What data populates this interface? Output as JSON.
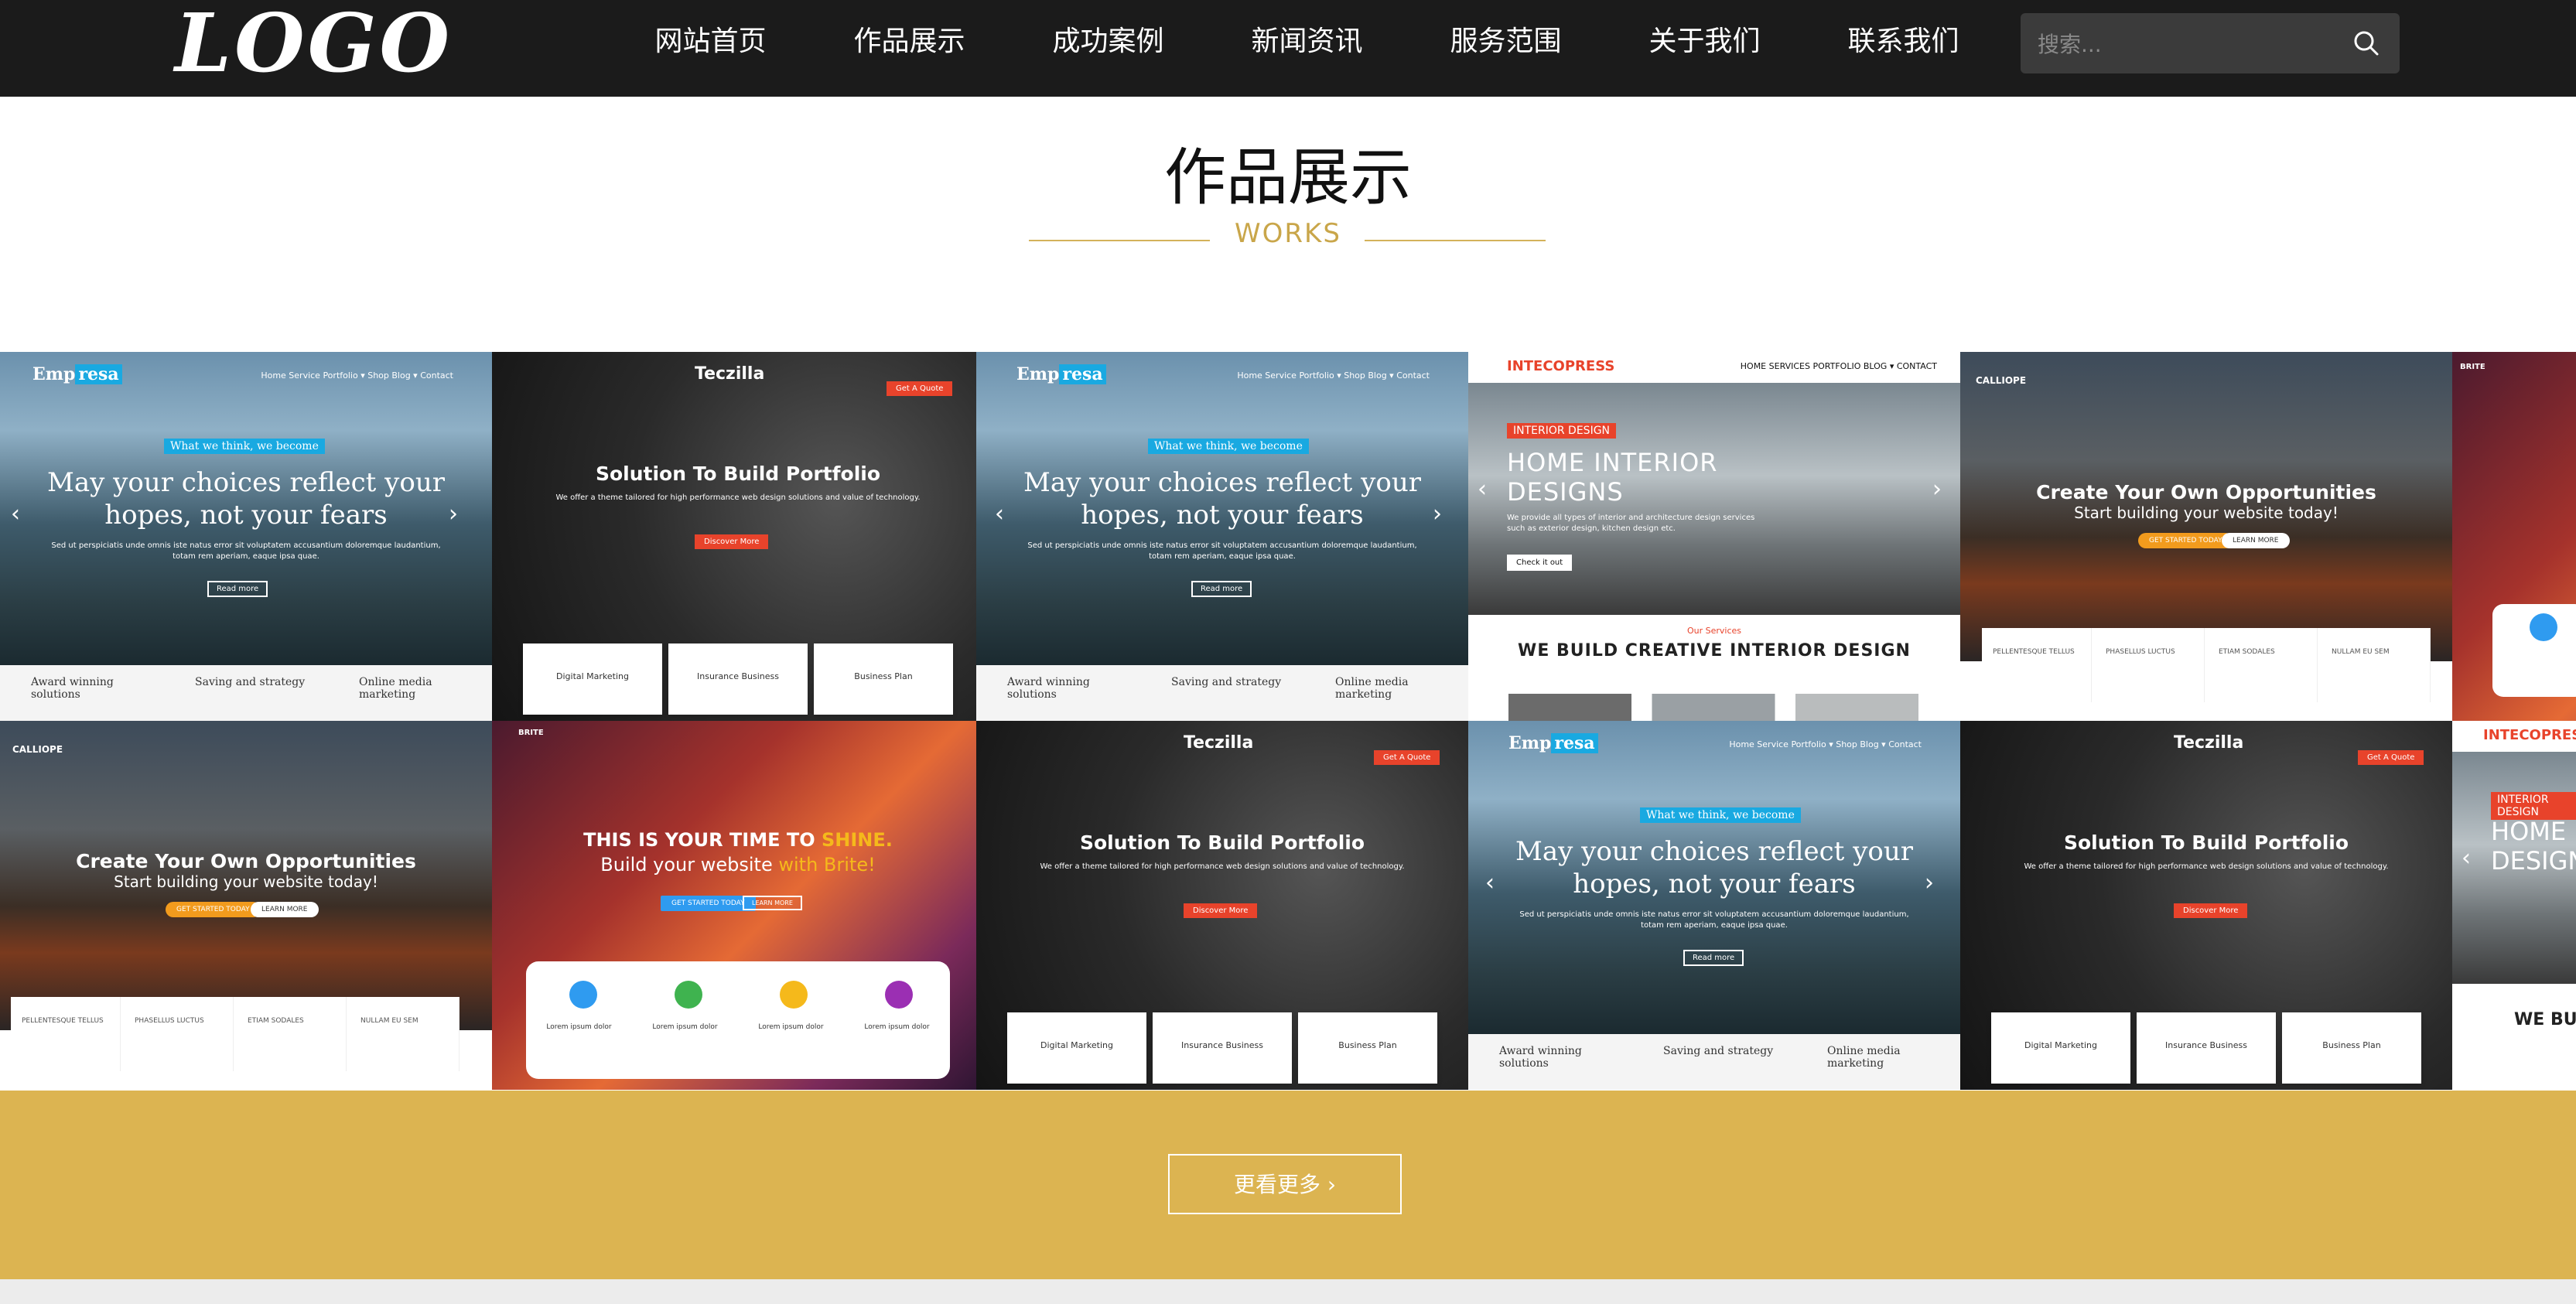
{
  "header": {
    "logo": "LOGO",
    "nav": [
      "网站首页",
      "作品展示",
      "成功案例",
      "新闻资讯",
      "服务范围",
      "关于我们",
      "联系我们"
    ],
    "search_placeholder": "搜索...",
    "search_icon": "search-icon"
  },
  "section": {
    "title": "作品展示",
    "subtitle": "WORKS"
  },
  "tiles": {
    "emp": {
      "logo_a": "Emp",
      "logo_b": "resa",
      "nav": "Home   Service   Portfolio ▾   Shop   Blog ▾   Contact",
      "tag": "What we think, we become",
      "headline": "May your choices reflect your hopes, not your fears",
      "para": "Sed ut perspiciatis unde omnis iste natus error sit voluptatem accusantium doloremque laudantium, totam rem aperiam, eaque ipsa quae.",
      "button": "Read more",
      "features": [
        "Award winning solutions",
        "Saving and strategy",
        "Online media marketing"
      ]
    },
    "tec": {
      "logo": "Teczilla",
      "headline": "Solution To Build Portfolio",
      "para": "We offer a theme tailored for high performance web design solutions and value of technology.",
      "button": "Discover More",
      "quote": "Get A Quote",
      "cards": [
        "Digital Marketing",
        "Insurance Business",
        "Business Plan"
      ]
    },
    "int": {
      "logo": "INTECOPRESS",
      "nav": "HOME   SERVICES   PORTFOLIO   BLOG ▾   CONTACT",
      "tag": "INTERIOR DESIGN",
      "headline": "HOME INTERIOR DESIGNS",
      "para": "We provide all types of interior and architecture design services such as exterior design, kitchen design etc.",
      "button": "Check it out",
      "kicker": "Our Services",
      "section": "WE BUILD CREATIVE INTERIOR DESIGN"
    },
    "cal": {
      "logo": "CALLIOPE",
      "headline": "Create Your Own Opportunities",
      "sub": "Start building your website today!",
      "btn1": "GET STARTED TODAY",
      "btn2": "LEARN MORE",
      "cards": [
        "PELLENTESQUE TELLUS",
        "PHASELLUS LUCTUS",
        "ETIAM SODALES",
        "NULLAM EU SEM"
      ]
    },
    "brite": {
      "logo": "BRITE",
      "line1": "THIS IS YOUR TIME TO ",
      "line1b": "SHINE.",
      "line2": "Build your website ",
      "line2b": "with Brite!",
      "btn1": "GET STARTED TODAY",
      "btn2": "LEARN MORE",
      "card_title": "Lorem ipsum dolor",
      "dot_colors": [
        "#2f9bf0",
        "#3fb34f",
        "#f5b91b",
        "#9b2fb3"
      ]
    }
  },
  "more_button": "更看更多 ›",
  "colors": {
    "gold": "#dcb451",
    "header_bg": "#1b1b1b",
    "accent_blue": "#19a9e1",
    "accent_red": "#e8432b"
  }
}
